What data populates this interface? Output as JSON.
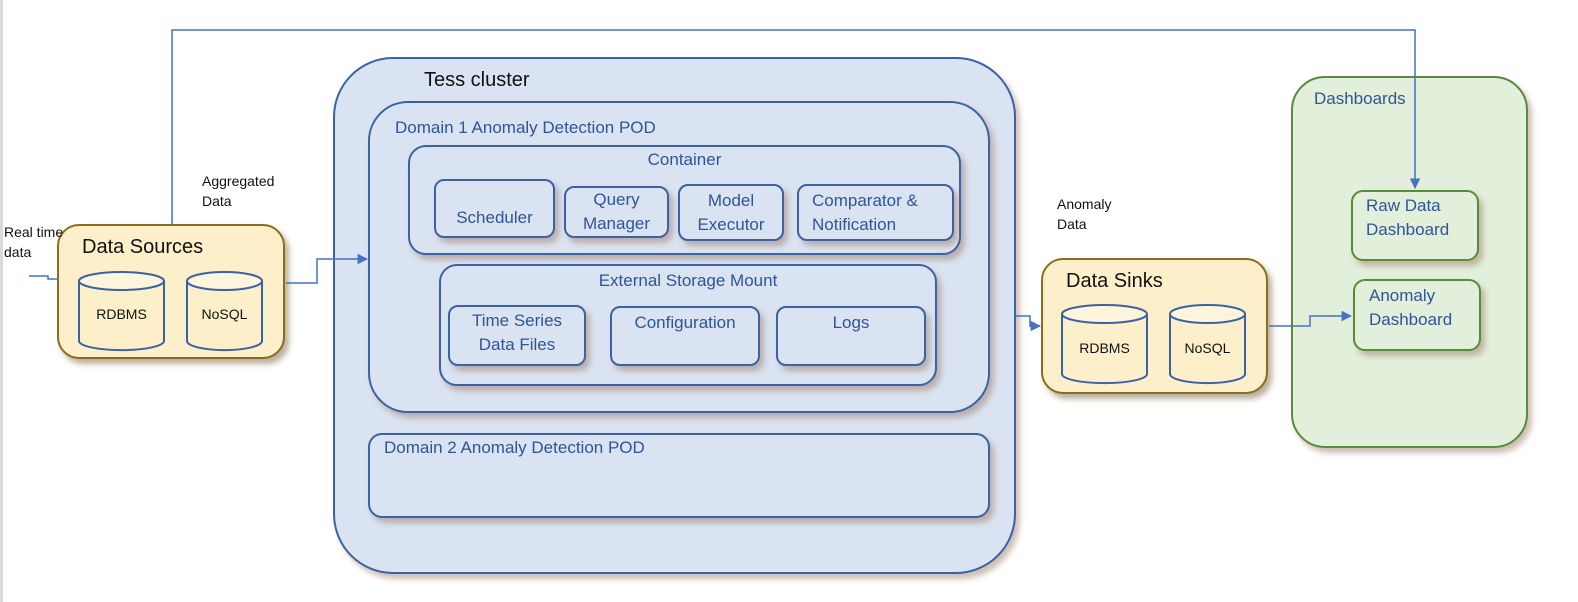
{
  "diagram": {
    "labels": {
      "real_time_data": [
        "Real time",
        "data"
      ],
      "aggregated_data": [
        "Aggregated",
        "Data"
      ],
      "anomaly_data": [
        "Anomaly",
        "Data"
      ]
    },
    "data_sources": {
      "title": "Data Sources",
      "stores": [
        "RDBMS",
        "NoSQL"
      ]
    },
    "tess_cluster": {
      "title": "Tess cluster",
      "pod1": {
        "title": "Domain 1 Anomaly Detection POD",
        "container": {
          "title": "Container",
          "components": [
            "Scheduler",
            "Query\nManager",
            "Model\nExecutor",
            "Comparator &\nNotification"
          ]
        },
        "storage": {
          "title": "External Storage Mount",
          "components": [
            "Time Series\nData Files",
            "Configuration",
            "Logs"
          ]
        }
      },
      "pod2": {
        "title": "Domain 2 Anomaly Detection POD"
      }
    },
    "data_sinks": {
      "title": "Data Sinks",
      "stores": [
        "RDBMS",
        "NoSQL"
      ]
    },
    "dashboards": {
      "title": "Dashboards",
      "items": [
        "Raw Data\nDashboard",
        "Anomaly\nDashboard"
      ]
    },
    "colors": {
      "connector": "#4472c4",
      "cluster_fill": "#dae3f1",
      "cluster_border": "#3b62a3",
      "store_fill": "#fdefc9",
      "store_border": "#8c6d1f",
      "dashboard_fill": "#e2efda",
      "dashboard_border": "#5a8a3c"
    }
  }
}
